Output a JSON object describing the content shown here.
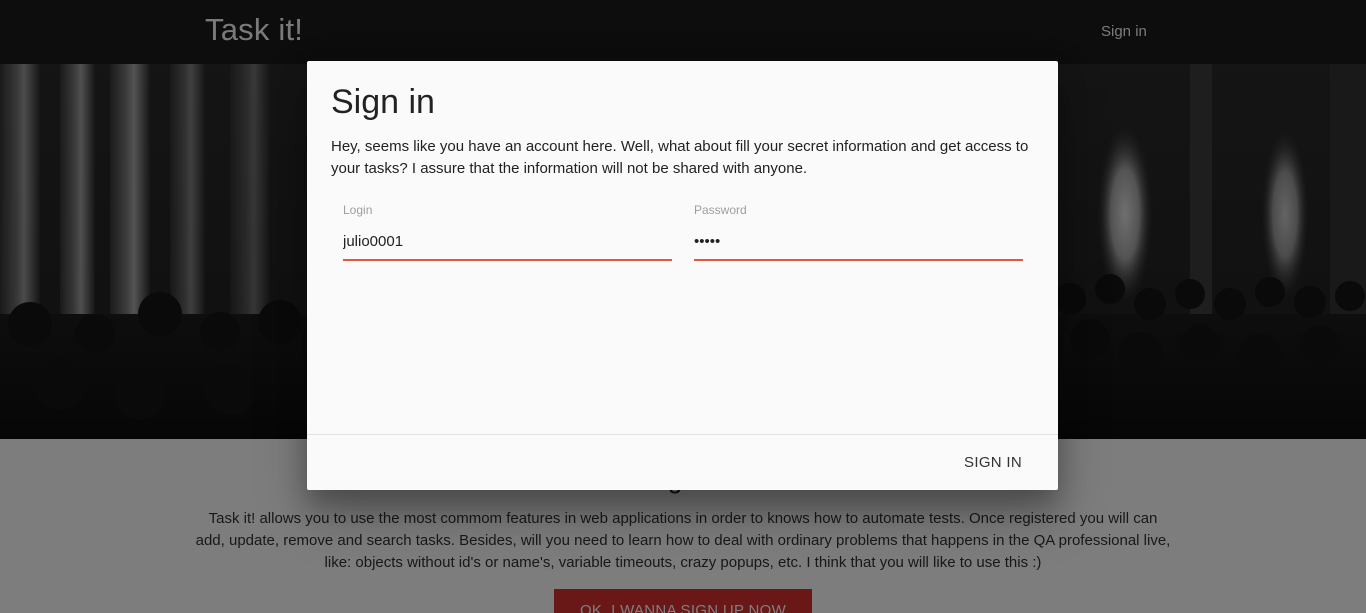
{
  "navbar": {
    "brand": "Task it!",
    "signin_link": "Sign in"
  },
  "section": {
    "heading": "Register",
    "description": "Task it! allows you to use the most commom features in web applications in order to knows how to automate tests. Once registered you will can add, update, remove and search tasks. Besides, will you need to learn how to deal with ordinary problems that happens in the QA professional live, like: objects without id's or name's, variable timeouts, crazy popups, etc. I think that you will like to use this :)",
    "signup_button": "OK, I WANNA SIGN UP NOW"
  },
  "modal": {
    "title": "Sign in",
    "description": "Hey, seems like you have an account here. Well, what about fill your secret information and get access to your tasks? I assure that the information will not be shared with anyone.",
    "login": {
      "label": "Login",
      "value": "julio0001"
    },
    "password": {
      "label": "Password",
      "value": "12345"
    },
    "submit_button": "SIGN IN"
  },
  "colors": {
    "accent": "#e0583f",
    "signup_button": "#d32f2f",
    "navbar": "#1b1b1b"
  }
}
